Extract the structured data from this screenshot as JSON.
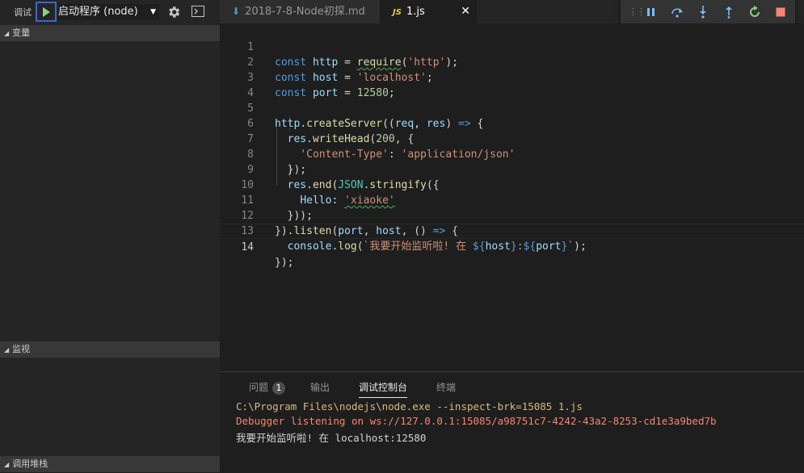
{
  "debug": {
    "title": "调试",
    "config": "启动程序 (node)",
    "sections": {
      "variables": "变量",
      "watch": "监视",
      "callstack": "调用堆栈"
    }
  },
  "tabs": [
    {
      "label": "2018-7-8-Node初探.md",
      "icon": "markdown-download-icon"
    },
    {
      "label": "1.js",
      "icon": "js-icon",
      "tag": "JS"
    }
  ],
  "debug_toolbar": {
    "icons": [
      "pause-icon",
      "step-over-icon",
      "step-into-icon",
      "step-out-icon",
      "restart-icon",
      "stop-icon"
    ]
  },
  "editor": {
    "active_line": 14,
    "line_numbers": [
      "1",
      "2",
      "3",
      "4",
      "5",
      "6",
      "7",
      "8",
      "9",
      "10",
      "11",
      "12",
      "13",
      "14"
    ],
    "lines": [
      "const http = require('http');",
      "const host = 'localhost';",
      "const port = 12580;",
      "",
      "http.createServer((req, res) => {",
      "  res.writeHead(200, {",
      "    'Content-Type': 'application/json'",
      "  });",
      "  res.end(JSON.stringify({",
      "    Hello: 'xiaoke'",
      "  }));",
      "}).listen(port, host, () => {",
      "  console.log(`我要开始监听啦! 在 ${host}:${port}`);",
      "});"
    ]
  },
  "panel": {
    "tabs": {
      "problems": "问题",
      "problems_count": "1",
      "output": "输出",
      "debug_console": "调试控制台",
      "terminal": "终端"
    },
    "console": [
      "C:\\Program Files\\nodejs\\node.exe --inspect-brk=15085 1.js",
      "Debugger listening on ws://127.0.0.1:15085/a98751c7-4242-43a2-8253-cd1e3a9bed7b",
      "我要开始监听啦! 在 localhost:12580"
    ]
  }
}
